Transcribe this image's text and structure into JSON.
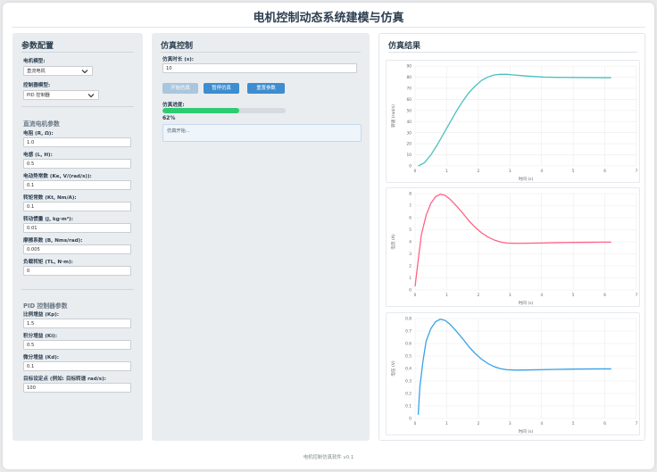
{
  "app": {
    "title": "电机控制动态系统建模与仿真",
    "footer": "电机控制仿真软件 v0.1"
  },
  "config": {
    "title": "参数配置",
    "motor_type_label": "电机模型:",
    "motor_type_value": "直流电机",
    "controller_type_label": "控制器模型:",
    "controller_type_value": "PID 控制器",
    "motor_section": "直流电机参数",
    "motor_params": [
      {
        "label": "电阻 (R, Ω):",
        "value": "1.0"
      },
      {
        "label": "电感 (L, H):",
        "value": "0.5"
      },
      {
        "label": "电动势常数 (Ke, V/(rad/s)):",
        "value": "0.1"
      },
      {
        "label": "转矩常数 (Kt, Nm/A):",
        "value": "0.1"
      },
      {
        "label": "转动惯量 (J, kg·m²):",
        "value": "0.01"
      },
      {
        "label": "摩擦系数 (B, Nms/rad):",
        "value": "0.005"
      },
      {
        "label": "负载转矩 (TL, N·m):",
        "value": "0"
      }
    ],
    "pid_section": "PID 控制器参数",
    "pid_params": [
      {
        "label": "比例增益 (Kp):",
        "value": "1.5"
      },
      {
        "label": "积分增益 (Ki):",
        "value": "0.5"
      },
      {
        "label": "微分增益 (Kd):",
        "value": "0.1"
      },
      {
        "label": "目标设定点 (例如: 目标转速 rad/s):",
        "value": "100"
      }
    ]
  },
  "control": {
    "title": "仿真控制",
    "duration_label": "仿真时长 (s):",
    "duration_value": "10",
    "start_label": "开始仿真",
    "pause_label": "暂停仿真",
    "reset_label": "重置参数",
    "progress_label": "仿真进度:",
    "progress_fraction": 0.62,
    "progress_text": "62%",
    "log_text": "仿真开始..."
  },
  "results": {
    "title": "仿真结果"
  },
  "colors": {
    "teal": "#4bc0c0",
    "red": "#ff6384",
    "blue": "#36a2eb",
    "green": "#2ecc71",
    "button": "#3d8dd0"
  },
  "chart_data": [
    {
      "type": "line",
      "ylabel": "转速 (rad/s)",
      "xlabel": "时间 (s)",
      "xlim": [
        0,
        7
      ],
      "ylim": [
        0,
        90
      ],
      "xticks": [
        0,
        1,
        2,
        3,
        4,
        5,
        6,
        7
      ],
      "yticks": [
        0,
        10,
        20,
        30,
        40,
        50,
        60,
        70,
        80,
        90
      ],
      "grid": true,
      "series": [
        {
          "color": "#4bc0c0",
          "x": [
            0.1,
            0.3,
            0.5,
            0.7,
            0.9,
            1.1,
            1.3,
            1.5,
            1.7,
            1.9,
            2.1,
            2.3,
            2.5,
            2.7,
            2.9,
            3.1,
            3.3,
            3.5,
            3.8,
            4.1,
            4.5,
            5.0,
            5.5,
            6.0,
            6.2
          ],
          "y": [
            0,
            3,
            10,
            19,
            29,
            39,
            49,
            58,
            66,
            72,
            77,
            80,
            82,
            82.5,
            82.5,
            82,
            81.5,
            81,
            80.5,
            80,
            79.8,
            79.7,
            79.6,
            79.5,
            79.5
          ]
        }
      ]
    },
    {
      "type": "line",
      "ylabel": "电流 (A)",
      "xlabel": "时间 (s)",
      "xlim": [
        0,
        7
      ],
      "ylim": [
        0,
        8
      ],
      "xticks": [
        0,
        1,
        2,
        3,
        4,
        5,
        6,
        7
      ],
      "yticks": [
        0,
        1,
        2,
        3,
        4,
        5,
        6,
        7,
        8
      ],
      "grid": true,
      "series": [
        {
          "color": "#ff6384",
          "x": [
            0.0,
            0.1,
            0.2,
            0.35,
            0.5,
            0.65,
            0.8,
            0.95,
            1.1,
            1.3,
            1.5,
            1.7,
            1.9,
            2.1,
            2.3,
            2.5,
            2.7,
            2.9,
            3.2,
            3.5,
            4.0,
            4.5,
            5.0,
            5.5,
            6.0,
            6.2
          ],
          "y": [
            0.3,
            2.5,
            4.6,
            6.2,
            7.2,
            7.75,
            7.95,
            7.85,
            7.55,
            7.0,
            6.4,
            5.75,
            5.2,
            4.75,
            4.4,
            4.15,
            3.98,
            3.9,
            3.87,
            3.88,
            3.9,
            3.93,
            3.95,
            3.96,
            3.97,
            3.97
          ]
        }
      ]
    },
    {
      "type": "line",
      "ylabel": "电压 (V)",
      "xlabel": "时间 (s)",
      "xlim": [
        0,
        7
      ],
      "ylim": [
        0,
        0.8
      ],
      "xticks": [
        0,
        1,
        2,
        3,
        4,
        5,
        6,
        7
      ],
      "yticks": [
        0,
        0.1,
        0.2,
        0.3,
        0.4,
        0.5,
        0.6,
        0.7,
        0.8
      ],
      "grid": true,
      "series": [
        {
          "color": "#36a2eb",
          "x": [
            0.1,
            0.15,
            0.25,
            0.35,
            0.5,
            0.65,
            0.8,
            0.95,
            1.1,
            1.3,
            1.5,
            1.7,
            1.9,
            2.1,
            2.3,
            2.5,
            2.7,
            2.9,
            3.2,
            3.5,
            4.0,
            4.5,
            5.0,
            5.5,
            6.0,
            6.2
          ],
          "y": [
            0.03,
            0.25,
            0.46,
            0.62,
            0.72,
            0.775,
            0.795,
            0.785,
            0.755,
            0.7,
            0.64,
            0.575,
            0.52,
            0.475,
            0.44,
            0.415,
            0.398,
            0.39,
            0.387,
            0.388,
            0.39,
            0.393,
            0.395,
            0.396,
            0.397,
            0.397
          ]
        }
      ]
    }
  ]
}
